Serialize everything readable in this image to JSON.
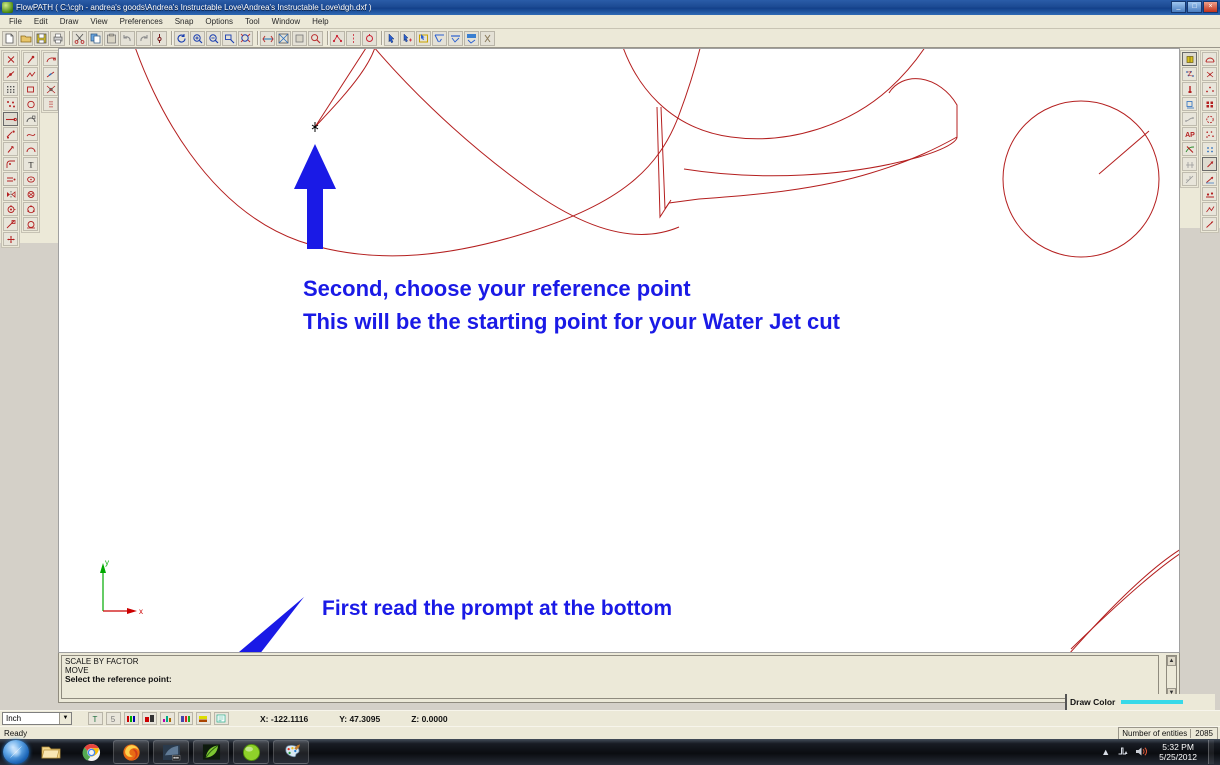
{
  "window": {
    "title": "FlowPATH ( C:\\cgh - andrea's goods\\Andrea's Instructable Love\\Andrea's Instructable Love\\dgh.dxf )",
    "icon": "flowpath-app-icon",
    "minimize_label": "_",
    "maximize_label": "□",
    "close_label": "×"
  },
  "menu": {
    "items": [
      {
        "label": "File"
      },
      {
        "label": "Edit"
      },
      {
        "label": "Draw"
      },
      {
        "label": "View"
      },
      {
        "label": "Preferences"
      },
      {
        "label": "Snap"
      },
      {
        "label": "Options"
      },
      {
        "label": "Tool"
      },
      {
        "label": "Window"
      },
      {
        "label": "Help"
      }
    ]
  },
  "toolbar": {
    "groups": [
      {
        "name": "file-group",
        "buttons": [
          {
            "icon": "new-file-icon",
            "label": "New"
          },
          {
            "icon": "open-folder-icon",
            "label": "Open"
          },
          {
            "icon": "save-disk-icon",
            "label": "Save"
          },
          {
            "icon": "print-icon",
            "label": "Print"
          }
        ]
      },
      {
        "name": "edit-group",
        "buttons": [
          {
            "icon": "cut-scissors-icon",
            "label": "Cut"
          },
          {
            "icon": "copy-icon",
            "label": "Copy"
          },
          {
            "icon": "paste-icon",
            "label": "Paste"
          },
          {
            "icon": "undo-arrow-icon",
            "label": "Undo"
          },
          {
            "icon": "redo-arrow-icon",
            "label": "Redo"
          },
          {
            "icon": "pick-entity-icon",
            "label": "Select Entity"
          }
        ]
      },
      {
        "name": "view-group",
        "buttons": [
          {
            "icon": "redraw-icon",
            "label": "Redraw"
          },
          {
            "icon": "zoom-in-icon",
            "label": "Zoom In"
          },
          {
            "icon": "zoom-out-icon",
            "label": "Zoom Out"
          },
          {
            "icon": "zoom-window-icon",
            "label": "Zoom Window"
          },
          {
            "icon": "zoom-extents-icon",
            "label": "Zoom Extents"
          }
        ]
      },
      {
        "name": "pan-group",
        "buttons": [
          {
            "icon": "pan-hand-icon",
            "label": "Pan"
          },
          {
            "icon": "zoom-all-icon",
            "label": "Zoom All"
          },
          {
            "icon": "zoom-previous-icon",
            "label": "Zoom Previous"
          },
          {
            "icon": "zoom-dynamic-icon",
            "label": "Zoom Dynamic"
          }
        ]
      },
      {
        "name": "path-group",
        "buttons": [
          {
            "icon": "path-node-icon",
            "label": "Path Nodes"
          },
          {
            "icon": "lead-in-icon",
            "label": "Lead In/Out"
          },
          {
            "icon": "traverse-icon",
            "label": "Traverse"
          }
        ]
      },
      {
        "name": "select-group",
        "buttons": [
          {
            "icon": "arrow-select-icon",
            "label": "Select"
          },
          {
            "icon": "chain-select-icon",
            "label": "Chain Select"
          },
          {
            "icon": "window-select-icon",
            "label": "Window Select"
          },
          {
            "icon": "crossing-select-icon",
            "label": "Crossing Select"
          },
          {
            "icon": "deselect-icon",
            "label": "Deselect"
          },
          {
            "icon": "select-all-icon",
            "label": "Select All"
          },
          {
            "icon": "clear-select-icon",
            "label": "Clear Selection"
          }
        ]
      }
    ]
  },
  "left_toolbox": {
    "columns": [
      {
        "name": "modify-column",
        "buttons": [
          {
            "icon": "delete-x-icon",
            "label": "Delete"
          },
          {
            "icon": "break-entity-icon",
            "label": "Break"
          },
          {
            "icon": "grid-icon",
            "label": "Grid"
          },
          {
            "icon": "scatter-points-icon",
            "label": "Points"
          },
          {
            "icon": "line-tool-icon",
            "label": "Line",
            "active": true
          },
          {
            "icon": "trim-icon",
            "label": "Trim"
          },
          {
            "icon": "extend-icon",
            "label": "Extend"
          },
          {
            "icon": "fillet-icon",
            "label": "Fillet"
          },
          {
            "icon": "offset-icon",
            "label": "Offset"
          },
          {
            "icon": "mirror-icon",
            "label": "Mirror"
          },
          {
            "icon": "rotate-icon",
            "label": "Rotate"
          },
          {
            "icon": "scale-icon",
            "label": "Scale"
          },
          {
            "icon": "move-icon",
            "label": "Move"
          }
        ]
      },
      {
        "name": "draw-column",
        "buttons": [
          {
            "icon": "point-draw-icon",
            "label": "Point"
          },
          {
            "icon": "polyline-icon",
            "label": "Polyline"
          },
          {
            "icon": "rectangle-icon",
            "label": "Rectangle"
          },
          {
            "icon": "circle-icon",
            "label": "Circle"
          },
          {
            "icon": "arc-icon",
            "label": "Arc"
          },
          {
            "icon": "spline-icon",
            "label": "Spline"
          },
          {
            "icon": "curve-icon",
            "label": "Curve"
          },
          {
            "icon": "text-tool-icon",
            "label": "Text"
          },
          {
            "icon": "ellipse-icon",
            "label": "Ellipse"
          },
          {
            "icon": "polygon-icon",
            "label": "Polygon"
          },
          {
            "icon": "circle-3pt-icon",
            "label": "Circle 3 Point"
          },
          {
            "icon": "circle-tangent-icon",
            "label": "Circle Tangent"
          }
        ]
      },
      {
        "name": "snap-column",
        "buttons": [
          {
            "icon": "snap-endpoint-icon",
            "label": "Snap Endpoint"
          },
          {
            "icon": "snap-midpoint-icon",
            "label": "Snap Midpoint"
          },
          {
            "icon": "snap-intersection-icon",
            "label": "Snap Intersection"
          },
          {
            "icon": "snap-perpendicular-icon",
            "label": "Snap Perpendicular"
          }
        ]
      }
    ]
  },
  "right_toolbox": {
    "columns": [
      {
        "name": "path-tools-column",
        "buttons": [
          {
            "icon": "autopath-icon",
            "label": "Auto Path",
            "active": true
          },
          {
            "icon": "path-points-icon",
            "label": "Path Points"
          },
          {
            "icon": "pierce-icon",
            "label": "Pierce"
          },
          {
            "icon": "quality-icon",
            "label": "Quality"
          },
          {
            "icon": "path-link-icon",
            "label": "Path Link"
          },
          {
            "icon": "ap-text-icon",
            "label": "AP"
          },
          {
            "icon": "no-path-icon",
            "label": "No Path"
          },
          {
            "icon": "dimension-icon",
            "label": "Dimension"
          },
          {
            "icon": "measure-icon",
            "label": "Measure"
          }
        ]
      },
      {
        "name": "edit-tools-column",
        "buttons": [
          {
            "icon": "lead-arc-icon",
            "label": "Lead Arc"
          },
          {
            "icon": "cleanup-icon",
            "label": "Cleanup"
          },
          {
            "icon": "nodes-icon",
            "label": "Nodes"
          },
          {
            "icon": "table-grid-icon",
            "label": "Table"
          },
          {
            "icon": "tabs-icon",
            "label": "Tabs"
          },
          {
            "icon": "sort-points-icon",
            "label": "Sort Points"
          },
          {
            "icon": "corner-points-icon",
            "label": "Corner Points"
          },
          {
            "icon": "start-point-icon",
            "label": "Start Point",
            "active": true
          },
          {
            "icon": "direction-icon",
            "label": "Direction"
          },
          {
            "icon": "reverse-icon",
            "label": "Reverse"
          },
          {
            "icon": "optimize-icon",
            "label": "Optimize"
          },
          {
            "icon": "verify-icon",
            "label": "Verify"
          }
        ]
      }
    ]
  },
  "canvas": {
    "axis": {
      "x_label": "x",
      "y_label": "y",
      "x_color": "#cc0000",
      "y_color": "#00aa00"
    },
    "geometry_color": "#b41f1f",
    "background": "#ffffff",
    "cursor": "crosshair-pick-cursor"
  },
  "annotations": [
    {
      "name": "annotation-second",
      "line1": "Second, choose your reference point",
      "line2": "This will be the starting point for your Water Jet cut",
      "color": "#1a1ae6",
      "arrow": "blue-up-arrow"
    },
    {
      "name": "annotation-first",
      "line1": "First read the prompt at the bottom",
      "color": "#1a1ae6",
      "arrow": "blue-diagonal-arrow"
    }
  ],
  "prompt": {
    "lines": [
      {
        "text": "SCALE BY FACTOR",
        "bold": false
      },
      {
        "text": "MOVE",
        "bold": false
      },
      {
        "text": "Select the reference point:",
        "bold": true
      }
    ],
    "scroll_up": "▲",
    "scroll_down": "▼"
  },
  "draw_color": {
    "label": "Draw Color",
    "color": "#38d9e8"
  },
  "status": {
    "unit": "Inch",
    "unit_arrow": "▼",
    "layer_buttons": [
      {
        "icon": "layer-top-icon",
        "label": "T"
      },
      {
        "icon": "layer-5-icon",
        "label": "5"
      },
      {
        "icon": "layer-xii-icon",
        "label": "xii"
      },
      {
        "icon": "layer-bars-icon",
        "label": "bars"
      },
      {
        "icon": "layer-chart-icon",
        "label": "chart"
      },
      {
        "icon": "layer-blocks-icon",
        "label": "blocks"
      },
      {
        "icon": "layer-stack-icon",
        "label": "stack"
      },
      {
        "icon": "layer-list-icon",
        "label": "list"
      }
    ],
    "coord_x": "X: -122.1116",
    "coord_y": "Y: 47.3095",
    "coord_z": "Z: 0.0000",
    "ready": "Ready",
    "entities_label": "Number of entities",
    "entities_value": "2085"
  },
  "taskbar": {
    "start": "start-orb",
    "apps": [
      {
        "icon": "windows-explorer-icon",
        "name": "explorer"
      },
      {
        "icon": "google-chrome-icon",
        "name": "chrome"
      },
      {
        "icon": "firefox-icon",
        "name": "firefox"
      },
      {
        "icon": "media-player-icon",
        "name": "media-player"
      },
      {
        "icon": "green-leaf-app-icon",
        "name": "app-green-leaf"
      },
      {
        "icon": "green-orb-app-icon",
        "name": "app-green-orb"
      },
      {
        "icon": "paint-palette-icon",
        "name": "paint"
      }
    ],
    "tray": {
      "show_hidden": "▲",
      "network": "network-icon",
      "volume": "volume-icon",
      "time": "5:32 PM",
      "date": "5/25/2012"
    }
  }
}
